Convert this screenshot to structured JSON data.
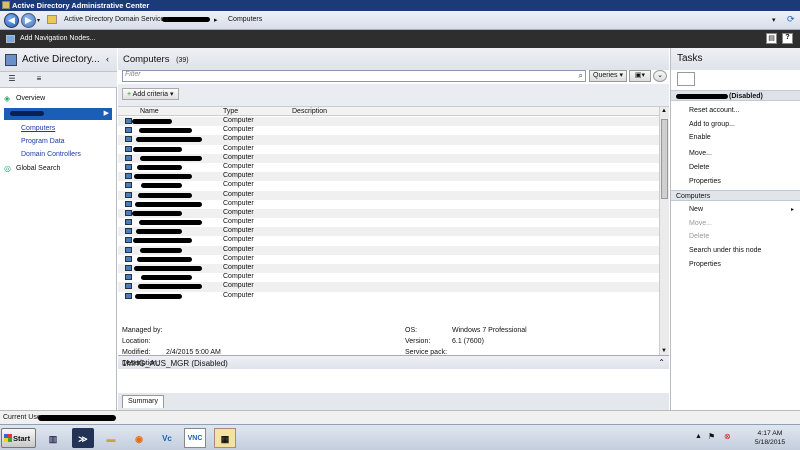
{
  "window": {
    "title": "Active Directory Administrative Center"
  },
  "addressbar": {
    "crumb1": "Active Directory Domain Services",
    "separator": "▸",
    "crumb2": "Computers"
  },
  "menu": {
    "add_nav_nodes": "Add Navigation Nodes..."
  },
  "left_panel": {
    "title": "Active Directory...",
    "items": [
      {
        "label": "Overview"
      },
      {
        "label": "Computers"
      },
      {
        "label": "Program Data"
      },
      {
        "label": "Domain Controllers"
      },
      {
        "label": "Global Search"
      }
    ]
  },
  "center": {
    "title": "Computers",
    "count": "(39)",
    "filter_placeholder": "Filter",
    "queries_label": "Queries",
    "add_criteria": "Add criteria",
    "columns": {
      "name": "Name",
      "type": "Type",
      "description": "Description"
    },
    "row_type": "Computer",
    "row_count": 20
  },
  "detail": {
    "title": "1MHG_AUS_MGR (Disabled)",
    "managed_by_label": "Managed by:",
    "location_label": "Location:",
    "modified_label": "Modified:",
    "modified_value": "2/4/2015 5:00 AM",
    "description_label": "Description:",
    "os_label": "OS:",
    "os_value": "Windows 7 Professional",
    "version_label": "Version:",
    "version_value": "6.1 (7600)",
    "service_pack_label": "Service pack:",
    "summary_tab": "Summary"
  },
  "tasks": {
    "title": "Tasks",
    "selected_header": "(Disabled)",
    "items": [
      "Reset account...",
      "Add to group...",
      "Enable",
      "Move...",
      "Delete",
      "Properties"
    ],
    "section": "Computers",
    "section_items": [
      "New",
      "Move...",
      "Delete",
      "Search under this node",
      "Properties"
    ],
    "new_arrow": "▸"
  },
  "status": {
    "text": "Current Use"
  },
  "taskbar": {
    "start": "Start",
    "time": "4:17 AM",
    "date": "5/18/2015"
  },
  "colors": {
    "title_bar": "#1a3b78",
    "selection": "#1a5eb8",
    "menu_bar": "#2e2e2e"
  }
}
